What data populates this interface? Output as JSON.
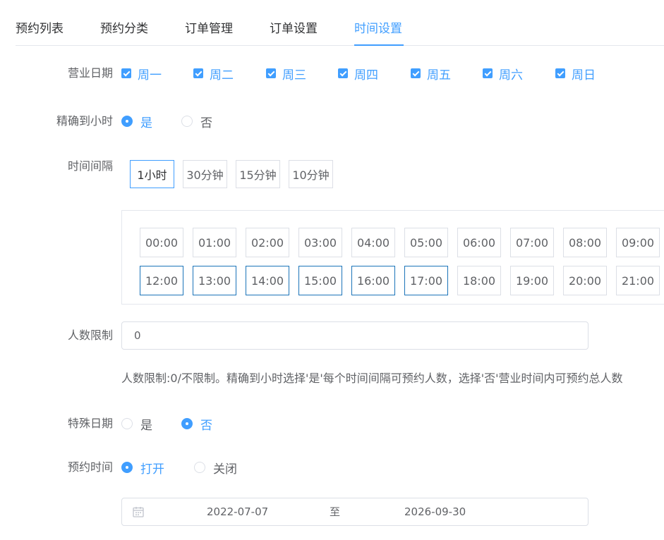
{
  "tabs": [
    {
      "label": "预约列表"
    },
    {
      "label": "预约分类"
    },
    {
      "label": "订单管理"
    },
    {
      "label": "订单设置"
    },
    {
      "label": "时间设置"
    }
  ],
  "active_tab": "时间设置",
  "form": {
    "business_days": {
      "label": "营业日期",
      "days": [
        "周一",
        "周二",
        "周三",
        "周四",
        "周五",
        "周六",
        "周日"
      ]
    },
    "precise_hour": {
      "label": "精确到小时",
      "options": [
        "是",
        "否"
      ],
      "selected": "是"
    },
    "interval": {
      "label": "时间间隔",
      "options": [
        "1小时",
        "30分钟",
        "15分钟",
        "10分钟"
      ],
      "selected": "1小时"
    },
    "time_slots": {
      "row1": [
        "00:00",
        "01:00",
        "02:00",
        "03:00",
        "04:00",
        "05:00",
        "06:00",
        "07:00",
        "08:00",
        "09:00"
      ],
      "row2": [
        "12:00",
        "13:00",
        "14:00",
        "15:00",
        "16:00",
        "17:00",
        "18:00",
        "19:00",
        "20:00",
        "21:00"
      ],
      "selected": [
        "12:00",
        "13:00",
        "14:00",
        "15:00",
        "16:00",
        "17:00"
      ]
    },
    "people_limit": {
      "label": "人数限制",
      "value": "0",
      "hint": "人数限制:0/不限制。精确到小时选择'是'每个时间间隔可预约人数，选择'否'营业时间内可预约总人数"
    },
    "special_date": {
      "label": "特殊日期",
      "options": [
        "是",
        "否"
      ],
      "selected": "否"
    },
    "booking_time": {
      "label": "预约时间",
      "options": [
        "打开",
        "关闭"
      ],
      "selected": "打开"
    },
    "date_range": {
      "start": "2022-07-07",
      "separator": "至",
      "end": "2026-09-30"
    }
  },
  "colors": {
    "accent": "#409eff",
    "slot_selected_border": "#1b74b9",
    "text": "#606266",
    "border": "#dcdfe6"
  },
  "icons": {
    "date_range": "calendar-icon",
    "checkbox": "check-icon"
  }
}
